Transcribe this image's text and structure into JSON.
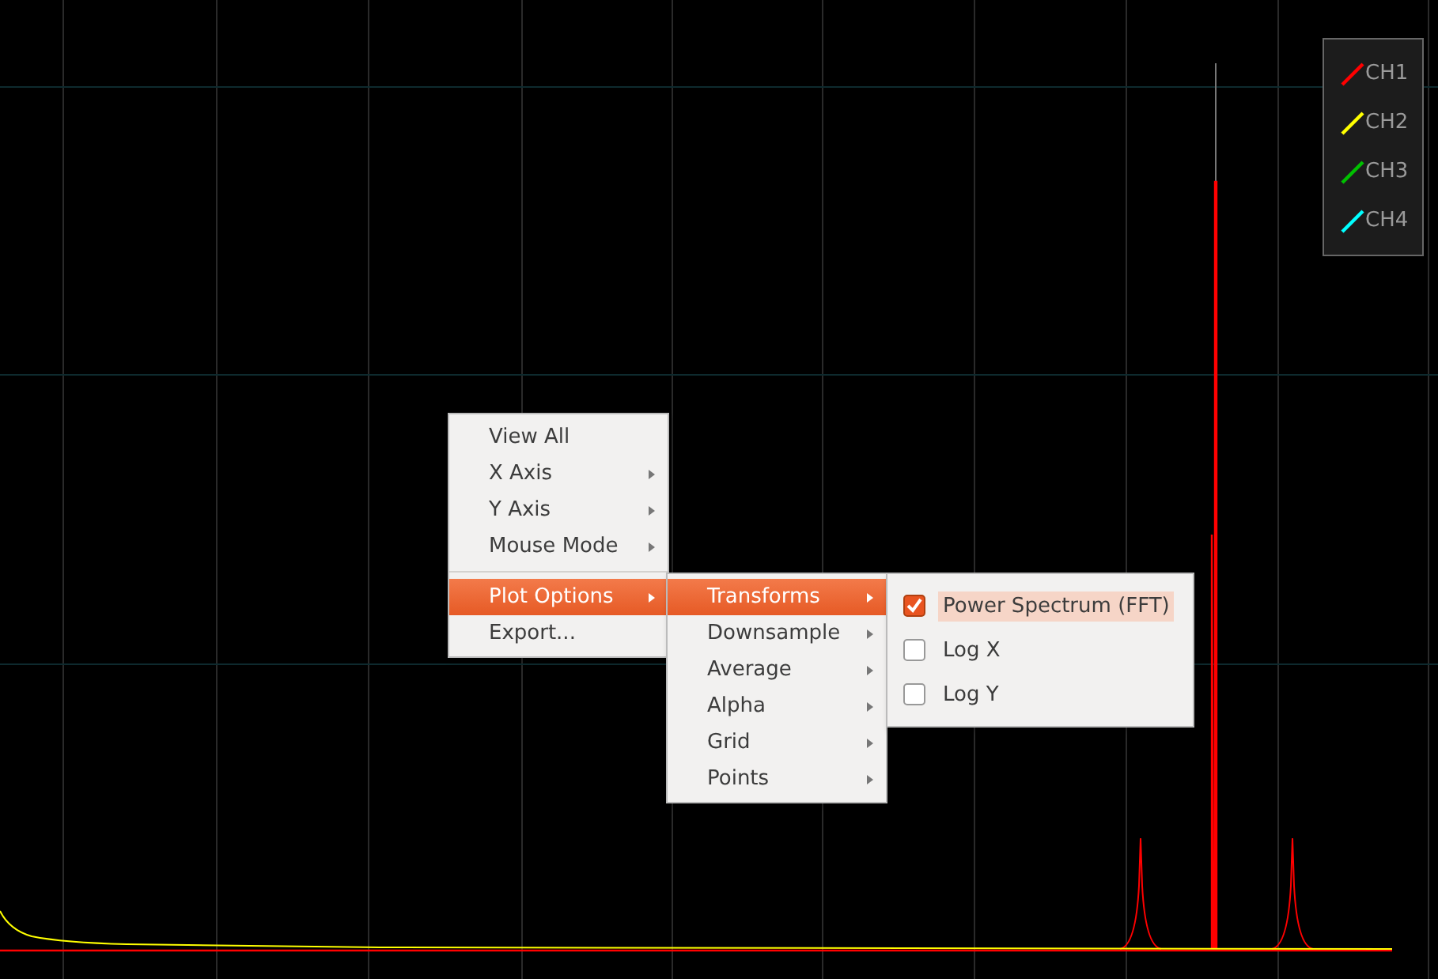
{
  "legend": [
    {
      "label": "CH1",
      "color": "#ff0000"
    },
    {
      "label": "CH2",
      "color": "#ffff00"
    },
    {
      "label": "CH3",
      "color": "#00c000"
    },
    {
      "label": "CH4",
      "color": "#00ffff"
    }
  ],
  "context_menu": [
    {
      "kind": "item",
      "label": "View All",
      "submenu": false,
      "selected": false
    },
    {
      "kind": "item",
      "label": "X Axis",
      "submenu": true,
      "selected": false
    },
    {
      "kind": "item",
      "label": "Y Axis",
      "submenu": true,
      "selected": false
    },
    {
      "kind": "item",
      "label": "Mouse Mode",
      "submenu": true,
      "selected": false
    },
    {
      "kind": "separator"
    },
    {
      "kind": "item",
      "label": "Plot Options",
      "submenu": true,
      "selected": true
    },
    {
      "kind": "item",
      "label": "Export...",
      "submenu": false,
      "selected": false
    }
  ],
  "plot_options_menu": [
    {
      "label": "Transforms",
      "selected": true
    },
    {
      "label": "Downsample",
      "selected": false
    },
    {
      "label": "Average",
      "selected": false
    },
    {
      "label": "Alpha",
      "selected": false
    },
    {
      "label": "Grid",
      "selected": false
    },
    {
      "label": "Points",
      "selected": false
    }
  ],
  "transforms_menu": [
    {
      "label": "Power Spectrum (FFT)",
      "checked": true,
      "selected": true
    },
    {
      "label": "Log X",
      "checked": false,
      "selected": false
    },
    {
      "label": "Log Y",
      "checked": false,
      "selected": false
    }
  ]
}
